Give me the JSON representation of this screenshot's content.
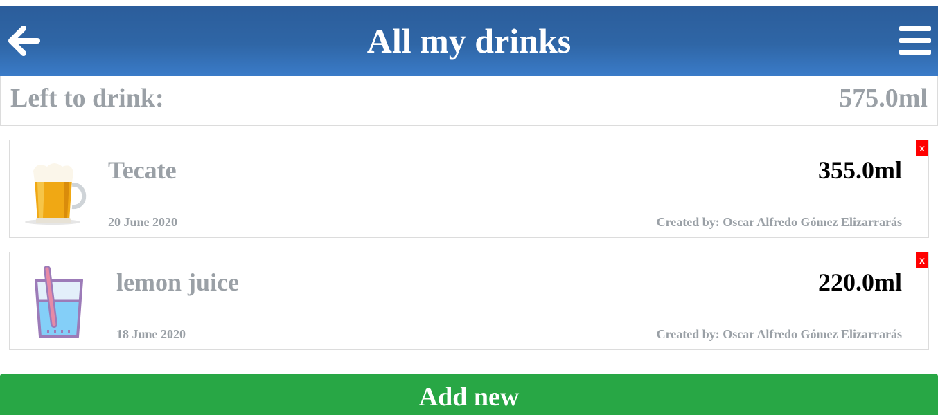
{
  "header": {
    "title": "All my drinks",
    "back_icon": "arrow-left-icon",
    "menu_icon": "hamburger-menu-icon",
    "bar_color": "#2f66a6"
  },
  "summary": {
    "label": "Left to drink:",
    "value": "575.0ml"
  },
  "drinks": [
    {
      "name": "Tecate",
      "amount": "355.0ml",
      "date": "20 June 2020",
      "creator": "Created by: Oscar Alfredo Gómez Elizarrarás",
      "icon": "beer-mug-icon",
      "delete_label": "x"
    },
    {
      "name": "lemon juice",
      "amount": "220.0ml",
      "date": "18 June 2020",
      "creator": "Created by: Oscar Alfredo Gómez Elizarrarás",
      "icon": "juice-glass-icon",
      "delete_label": "x"
    }
  ],
  "actions": {
    "add_label": "Add new",
    "add_color": "#28a745",
    "delete_color": "#ff0000"
  }
}
